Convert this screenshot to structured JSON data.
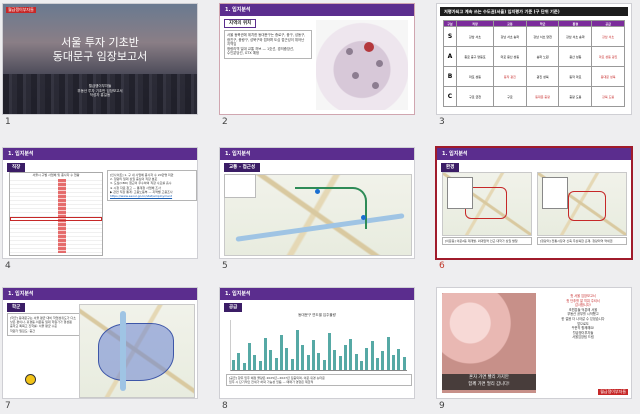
{
  "app": {
    "view": "Slide Sorter"
  },
  "slides": [
    {
      "number": "1",
      "brand": "월급쟁이부자들",
      "title_line1": "서울 투자 기초반",
      "title_line2": "동대문구 임장보고서",
      "meta_line1": "월급쟁이부자들",
      "meta_line2": "부동산 투자 기초반 임장보고서",
      "meta_line3": "작성자 홍길동"
    },
    {
      "number": "2",
      "header": "1. 입지분석",
      "subhead": "지역의 위치",
      "body_lines": [
        "서울 동북권에 위치한 동대문구는 종로구, 중구, 성동구,",
        "광진구, 중랑구, 성북구와 접하며 도심 접근성이 뛰어난",
        "지역임",
        "청량리역 일대 교통 허브 — 1호선, 경의중앙선,",
        "수인분당선, GTX 예정"
      ]
    },
    {
      "number": "3",
      "title": "저평가되고 계속 쓰는 수도권(서울) 입지평가 기준 (구 단위 기준)",
      "columns": [
        "구분",
        "직장",
        "교통",
        "학군",
        "환경",
        "공급"
      ],
      "rows": [
        {
          "grade": "S",
          "cells": [
            "강남 서초",
            "강남 서초 송파",
            "강남 서초 양천",
            "강남 서초 송파",
            "강남 서초"
          ]
        },
        {
          "grade": "A",
          "cells": [
            "종로 중구 영등포",
            "마포 용산 성동",
            "송파 노원",
            "용산 성동",
            "마포 성동 광진"
          ]
        },
        {
          "grade": "B",
          "cells": [
            "마포 성동",
            "동작 광진",
            "광진 성북",
            "동작 마포",
            "동대문 성북"
          ]
        },
        {
          "grade": "C",
          "cells": [
            "구로 금천",
            "구로",
            "동대문 중랑",
            "중랑 도봉",
            "강북 도봉"
          ]
        }
      ]
    },
    {
      "number": "4",
      "header": "1. 입지분석",
      "subhead": "직장",
      "table_title": "서울시 구별 사업체 및 종사자 수 현황",
      "note_lines": [
        "[인사이트] 1. 구 내 사업체 종사자 수 20만명 미만",
        "2. 청량리 일대 상권 중심의 직장 분포",
        "3. 도심(CBD) 접근이 우수하여 직장 수요를 흡수",
        "※ 시청 자료 참고 — 통계청 사업체 조사",
        "▶ 관련 직장 통계: 고용노동부 — 지역별 고용조사",
        "https://www.seoul.go.kr/stat/employment"
      ]
    },
    {
      "number": "5",
      "header": "1. 입지분석",
      "subhead": "교통 – 접근성"
    },
    {
      "number": "6",
      "header": "1. 입지분석",
      "subhead": "환경",
      "caption_left": "[이문동] 이문2동 재개발, 외대앞역 인근 대학가 상권 발달",
      "caption_right": "[청량리] 전통시장과 신축 주상복합 혼재, 청량리역 역세권"
    },
    {
      "number": "7",
      "header": "1. 입지분석",
      "subhead": "학군",
      "note_lines": [
        "[학군] 동대문구는 서울 평균 대비 학업성취도가 다소",
        "낮은 편이나, 휘경동·이문동 일대 학원가가 형성됨",
        "중학교 특목고 진학률: 서울 평균 수준",
        "학원가 밀집도: 중간"
      ]
    },
    {
      "number": "8",
      "header": "1. 입지분석",
      "subhead": "공급",
      "chart_title": "동대문구 연도별 입주물량",
      "note_lines": [
        "[공급] 향후 입주 예정 물량은 2025년~2027년 집중되며, 이문·휘경 뉴타운",
        "입주 시 단기적인 전세가 하락 가능성 있음 — 매매가 영향은 제한적"
      ]
    },
    {
      "number": "9",
      "brand": "월급쟁이부자들",
      "quote_lines": [
        "혼자 가면 빨리 가지만",
        "함께 가면 멀리 갑니다!"
      ],
      "message_lines": [
        "첫 서울 임장보고서",
        "첫 단추를 잘 끼워 주셔서",
        "감사합니다!",
        "조원분들 덕분에 서울",
        "부동산 공부를 시작했고",
        "한 걸음 더 나아갈 수 있었습니다",
        "앞으로도",
        "꾸준히 함께해요!",
        "월급쟁이부자들",
        "서울임장팀 드림"
      ]
    }
  ],
  "chart_data": {
    "type": "bar",
    "title": "동대문구 연도별 입주물량",
    "categories": [
      "1",
      "2",
      "3",
      "4",
      "5",
      "6",
      "7",
      "8",
      "9",
      "10",
      "11",
      "12",
      "13",
      "14",
      "15",
      "16",
      "17",
      "18",
      "19",
      "20",
      "21",
      "22",
      "23",
      "24",
      "25",
      "26",
      "27",
      "28",
      "29",
      "30",
      "31",
      "32",
      "33"
    ],
    "values": [
      20,
      35,
      15,
      55,
      30,
      18,
      65,
      40,
      25,
      70,
      45,
      22,
      80,
      50,
      30,
      60,
      35,
      20,
      75,
      40,
      28,
      50,
      62,
      33,
      18,
      45,
      58,
      24,
      38,
      66,
      30,
      42,
      26
    ],
    "ylim": [
      0,
      100
    ]
  }
}
